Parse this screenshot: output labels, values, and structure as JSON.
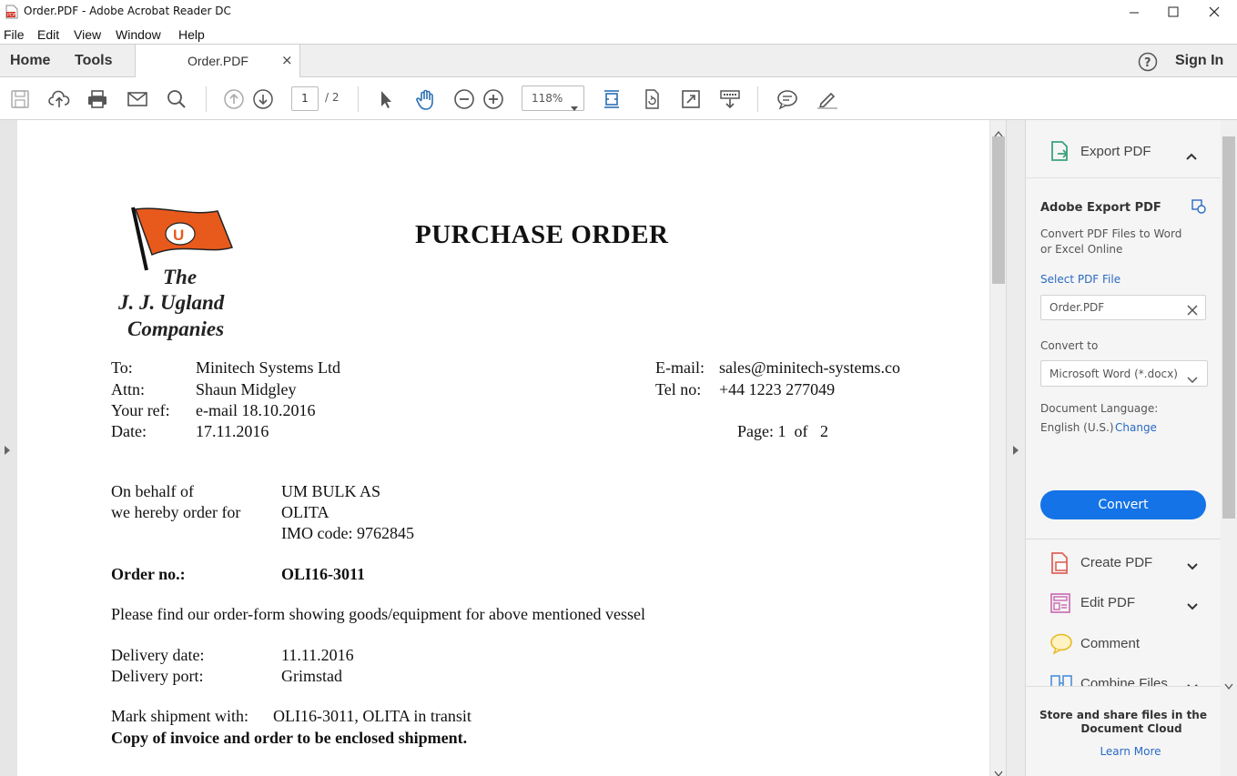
{
  "window": {
    "title": "Order.PDF - Adobe Acrobat Reader DC",
    "minimize_glyph": "—",
    "maximize_glyph": "☐",
    "close_glyph": "✕"
  },
  "menu": [
    "File",
    "Edit",
    "View",
    "Window",
    "Help"
  ],
  "tabs": {
    "home": "Home",
    "tools": "Tools",
    "document": "Order.PDF",
    "document_close": "×",
    "sign_in": "Sign In"
  },
  "toolbar": {
    "page_current": "1",
    "page_total": "/ 2",
    "zoom": "118%",
    "icons": [
      "save-icon",
      "upload-icon",
      "print-icon",
      "email-icon",
      "search-icon",
      "prev-page-icon",
      "next-page-icon",
      "select-arrow-icon",
      "hand-icon",
      "zoom-out-icon",
      "zoom-in-icon",
      "fit-width-icon",
      "rotate-icon",
      "fullscreen-icon",
      "read-mode-icon",
      "comment-icon",
      "highlight-pen-icon"
    ]
  },
  "document": {
    "logo": {
      "line1": "The",
      "line2": "J. J. Ugland",
      "line3": "Companies",
      "flag_letter": "U",
      "flag_color": "#e85a1c"
    },
    "title": "PURCHASE ORDER",
    "to_label": "To:",
    "to_value": "Minitech Systems Ltd",
    "attn_label": "Attn:",
    "attn_value": "Shaun Midgley",
    "ref_label": "Your ref:",
    "ref_value": "e-mail 18.10.2016",
    "date_label": "Date:",
    "date_value": "17.11.2016",
    "email_label": "E-mail:",
    "email_value": "sales@minitech-systems.co",
    "tel_label": "Tel no:",
    "tel_value": "+44 1223 277049",
    "page_info": "Page: 1  of   2",
    "behalf_label1": "On behalf of",
    "behalf_label2": "we hereby order for",
    "behalf_company": "UM BULK AS",
    "behalf_vessel": "OLITA",
    "behalf_imo": "IMO code: 9762845",
    "order_label": "Order no.:",
    "order_value": "OLI16-3011",
    "please_text": "Please find our order-form showing goods/equipment for above mentioned vessel",
    "delivery_date_label": "Delivery date:",
    "delivery_date_value": "11.11.2016",
    "delivery_port_label": "Delivery port:",
    "delivery_port_value": "Grimstad",
    "mark_label": "Mark shipment with:",
    "mark_value": "OLI16-3011, OLITA in transit",
    "copy_text": "Copy of invoice and order to be enclosed shipment."
  },
  "right_panel": {
    "export_title": "Export PDF",
    "adobe_export_title": "Adobe Export PDF",
    "description_line1": "Convert PDF Files to Word",
    "description_line2": "or Excel Online",
    "select_file": "Select PDF File",
    "file_name": "Order.PDF",
    "convert_to": "Convert to",
    "convert_format": "Microsoft Word (*.docx)",
    "doc_language": "Document Language:",
    "language_value": "English (U.S.)",
    "change": "Change",
    "convert_button": "Convert",
    "tools": [
      "Create PDF",
      "Edit PDF",
      "Comment",
      "Combine Files"
    ],
    "cloud_line1": "Store and share files in the",
    "cloud_line2": "Document Cloud",
    "learn_more": "Learn More"
  },
  "colors": {
    "accent": "#1473e6",
    "link": "#2a6ac2",
    "icon": "#5a5a5a",
    "toolbar_blue": "#2b6fb6"
  }
}
